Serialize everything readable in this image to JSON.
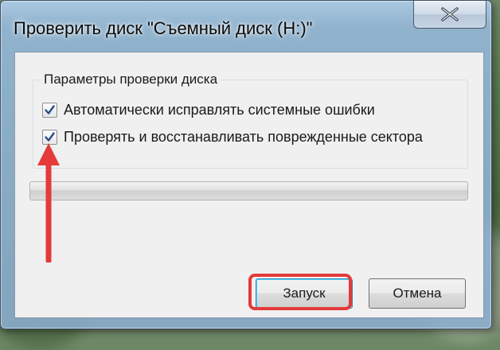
{
  "window": {
    "title": "Проверить диск \"Съемный диск (H:)\""
  },
  "options_group": {
    "legend": "Параметры проверки диска",
    "options": [
      {
        "label": "Автоматически исправлять системные ошибки",
        "checked": true
      },
      {
        "label": "Проверять и восстанавливать поврежденные сектора",
        "checked": true
      }
    ]
  },
  "progress": {
    "value": 0
  },
  "buttons": {
    "start_label": "Запуск",
    "cancel_label": "Отмена"
  },
  "annotation": {
    "highlight_color": "#e43a3a"
  }
}
